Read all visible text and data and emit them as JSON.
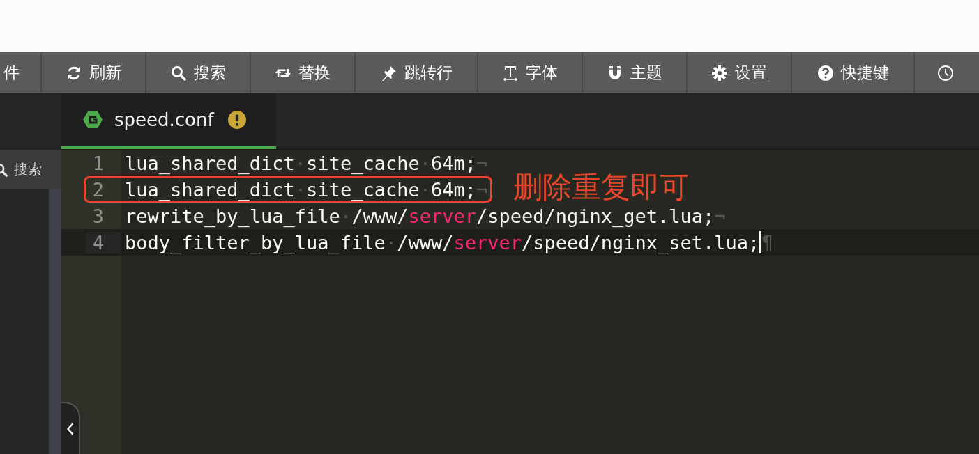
{
  "toolbar": [
    {
      "kind": "none",
      "label": "件"
    },
    {
      "kind": "refresh",
      "label": "刷新"
    },
    {
      "kind": "search",
      "label": "搜索"
    },
    {
      "kind": "replace",
      "label": "替换"
    },
    {
      "kind": "pin",
      "label": "跳转行"
    },
    {
      "kind": "font",
      "label": "字体"
    },
    {
      "kind": "magnet",
      "label": "主题"
    },
    {
      "kind": "gear",
      "label": "设置"
    },
    {
      "kind": "help",
      "label": "快捷键"
    },
    {
      "kind": "clock"
    }
  ],
  "sidebar": {
    "search_button": "搜索"
  },
  "tabs": [
    {
      "title": "speed.conf",
      "selected": true,
      "warning": true
    }
  ],
  "lines": [
    {
      "number": "1",
      "active": false,
      "flagged": false,
      "tokens": [
        {
          "kind": "plain",
          "text": "lua_shared_dict"
        },
        {
          "kind": "space",
          "text": "·"
        },
        {
          "kind": "plain",
          "text": "site_cache"
        },
        {
          "kind": "space",
          "text": "·"
        },
        {
          "kind": "plain",
          "text": "64m;"
        },
        {
          "kind": "eol",
          "text": "¬"
        }
      ]
    },
    {
      "number": "2",
      "active": false,
      "flagged": true,
      "tokens": [
        {
          "kind": "plain",
          "text": "lua_shared_dict"
        },
        {
          "kind": "space",
          "text": "·"
        },
        {
          "kind": "plain",
          "text": "site_cache"
        },
        {
          "kind": "space",
          "text": "·"
        },
        {
          "kind": "plain",
          "text": "64m;"
        },
        {
          "kind": "eol",
          "text": "¬"
        }
      ]
    },
    {
      "number": "3",
      "active": false,
      "flagged": false,
      "tokens": [
        {
          "kind": "plain",
          "text": "rewrite_by_lua_file"
        },
        {
          "kind": "space",
          "text": "·"
        },
        {
          "kind": "plain",
          "text": "/www/"
        },
        {
          "kind": "keyword",
          "text": "server"
        },
        {
          "kind": "plain",
          "text": "/speed/nginx_get.lua;"
        },
        {
          "kind": "eol",
          "text": "¬"
        }
      ]
    },
    {
      "number": "4",
      "active": true,
      "flagged": false,
      "tokens": [
        {
          "kind": "plain",
          "text": "body_filter_by_lua_file"
        },
        {
          "kind": "space",
          "text": "·"
        },
        {
          "kind": "plain",
          "text": "/www/"
        },
        {
          "kind": "keyword",
          "text": "server"
        },
        {
          "kind": "plain",
          "text": "/speed/nginx_set.lua;"
        },
        {
          "kind": "cursor"
        },
        {
          "kind": "eol",
          "text": "¶"
        }
      ]
    }
  ],
  "annotation": {
    "text": "删除重复即可"
  }
}
